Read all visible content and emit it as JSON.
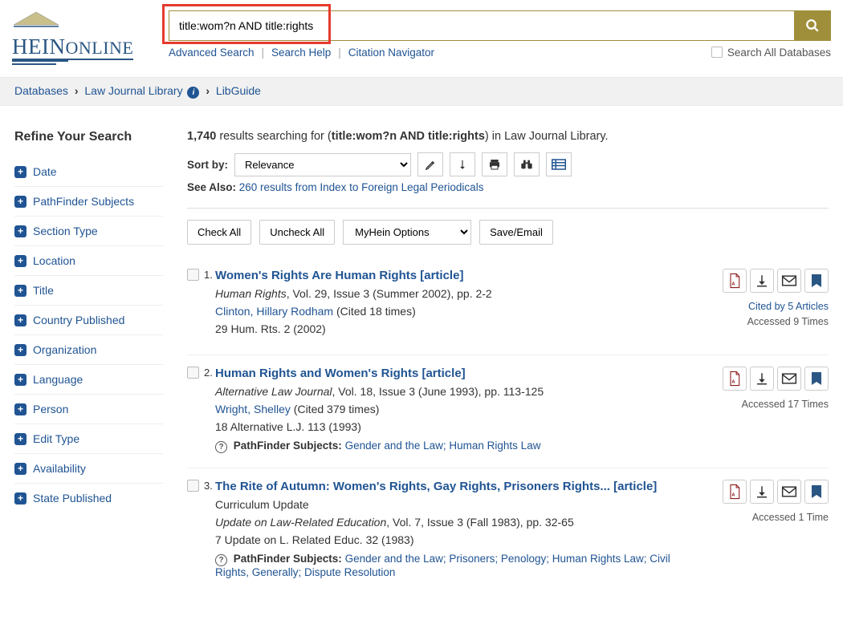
{
  "logo": {
    "main": "HEIN",
    "suffix": "ONLINE"
  },
  "search": {
    "value": "title:wom?n AND title:rights",
    "btn_aria": "Search",
    "links": {
      "advanced": "Advanced Search",
      "help": "Search Help",
      "citation": "Citation Navigator"
    },
    "search_all": "Search All Databases"
  },
  "breadcrumb": {
    "databases": "Databases",
    "ljl": "Law Journal Library",
    "libguide": "LibGuide"
  },
  "sidebar": {
    "title": "Refine Your Search",
    "facets": [
      "Date",
      "PathFinder Subjects",
      "Section Type",
      "Location",
      "Title",
      "Country Published",
      "Organization",
      "Language",
      "Person",
      "Edit Type",
      "Availability",
      "State Published"
    ]
  },
  "results_header": {
    "count": "1,740",
    "prefix": " results searching for (",
    "query": "title:wom?n AND title:rights",
    "suffix": ") in Law Journal Library."
  },
  "sort": {
    "label": "Sort by:",
    "selected": "Relevance"
  },
  "see_also": {
    "label": "See Also: ",
    "link": "260 results from Index to Foreign Legal Periodicals"
  },
  "controls": {
    "check_all": "Check All",
    "uncheck_all": "Uncheck All",
    "myhein": "MyHein Options",
    "save": "Save/Email"
  },
  "pf_label": "PathFinder Subjects:",
  "results": [
    {
      "num": "1.",
      "title": "Women's Rights Are Human Rights [article]",
      "source_em": "Human Rights",
      "source_rest": ", Vol. 29, Issue 3 (Summer 2002), pp. 2-2",
      "author": "Clinton, Hillary Rodham",
      "cited": " (Cited 18 times)",
      "citation": "29 Hum. Rts. 2 (2002)",
      "cited_by": "Cited by 5 Articles",
      "accessed": "Accessed 9 Times"
    },
    {
      "num": "2.",
      "title": "Human Rights and Women's Rights [article]",
      "source_em": "Alternative Law Journal",
      "source_rest": ", Vol. 18, Issue 3 (June 1993), pp. 113-125",
      "author": "Wright, Shelley",
      "cited": " (Cited 379 times)",
      "citation": "18 Alternative L.J. 113 (1993)",
      "pf": "Gender and the Law; Human Rights Law",
      "accessed": "Accessed 17 Times"
    },
    {
      "num": "3.",
      "title": "The Rite of Autumn: Women's Rights, Gay Rights, Prisoners Rights... [article]",
      "subtitle": "Curriculum Update",
      "source_em": "Update on Law-Related Education",
      "source_rest": ", Vol. 7, Issue 3 (Fall 1983), pp. 32-65",
      "citation": "7 Update on L. Related Educ. 32 (1983)",
      "pf": "Gender and the Law; Prisoners; Penology; Human Rights Law; Civil Rights, Generally; Dispute Resolution",
      "accessed": "Accessed 1 Time"
    }
  ]
}
